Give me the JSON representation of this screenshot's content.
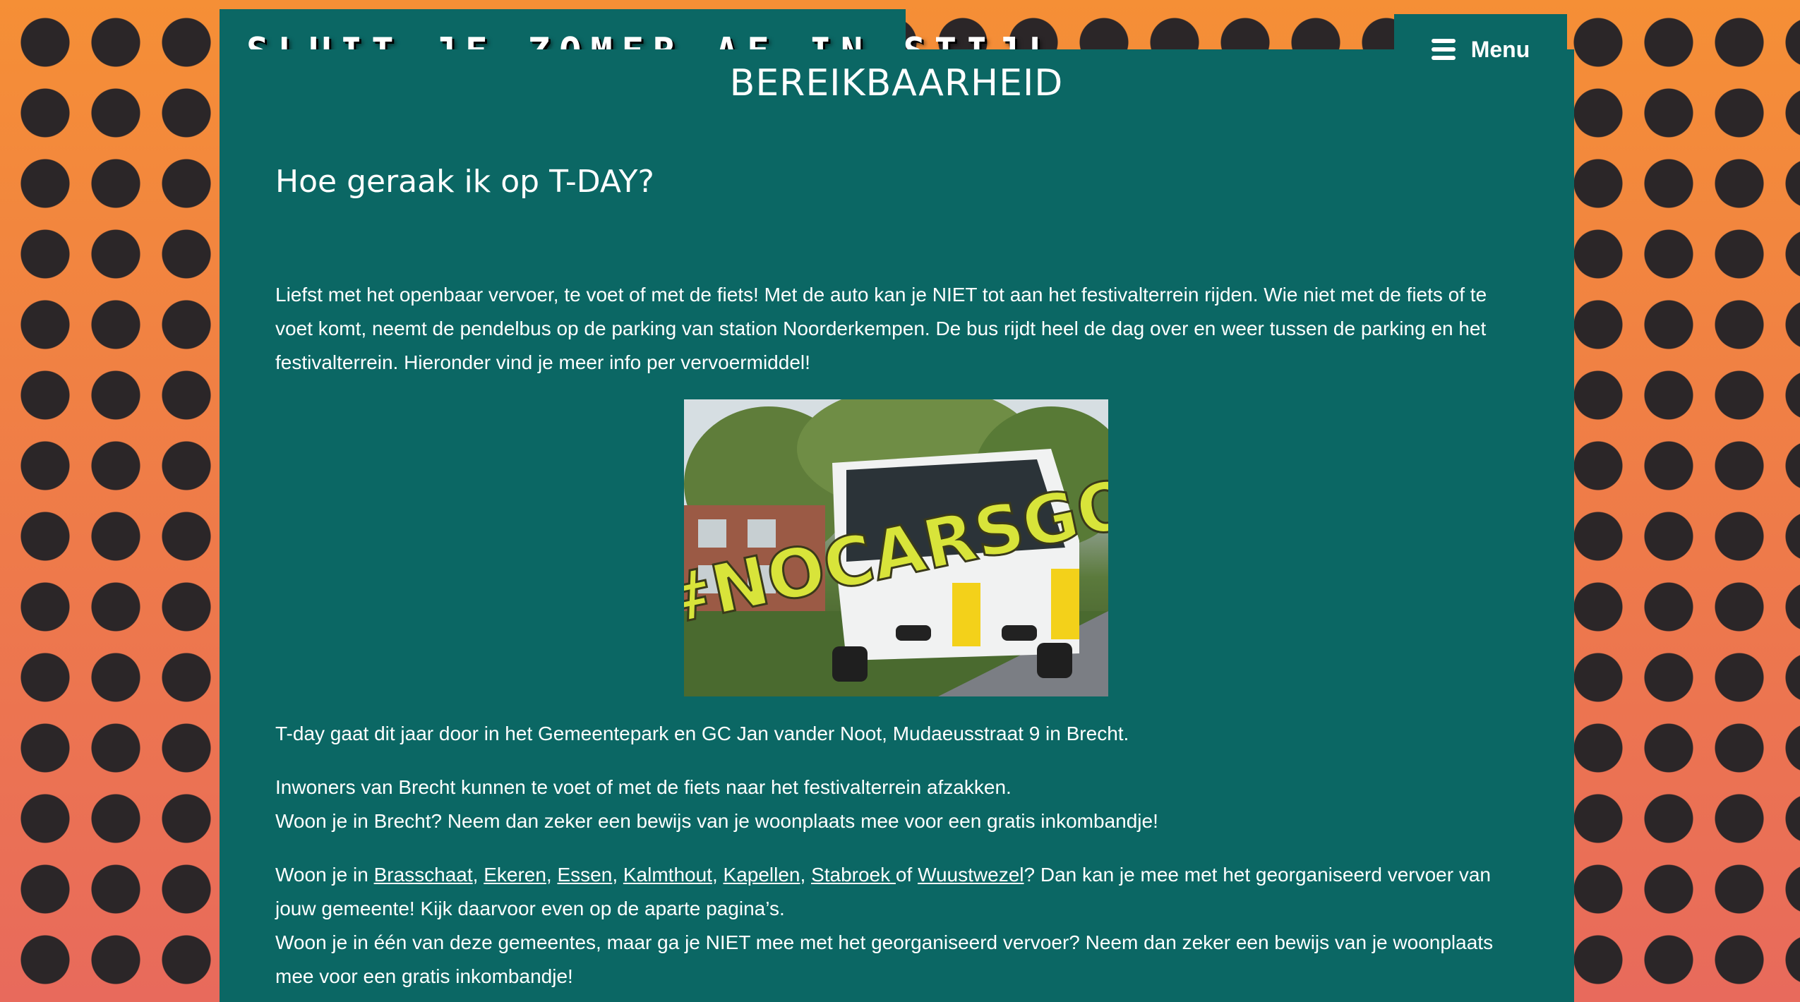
{
  "header": {
    "site_title": "SLUIT JE ZOMER AF IN STIJL",
    "menu_label": "Menu",
    "menu_icon": "hamburger-icon"
  },
  "main": {
    "page_title": "BEREIKBAARHEID",
    "section_title": "Hoe geraak ik op T-DAY?",
    "intro": "Liefst met het openbaar vervoer, te voet of met de fiets! Met de auto kan je NIET tot aan het festivalterrein rijden. Wie niet met de fiets of te voet komt, neemt de pendelbus op de parking van station Noorderkempen. De bus rijdt heel de dag over en weer tussen de parking en het festivalterrein. Hieronder vind je meer info per vervoermiddel!",
    "image": {
      "overlay_text": "#NOCARSGO"
    },
    "location": "T-day gaat dit jaar door in het Gemeentepark en GC Jan vander Noot, Mudaeusstraat 9 in Brecht.",
    "brecht_line1": "Inwoners van Brecht kunnen te voet of met de fiets naar het festivalterrein afzakken.",
    "brecht_line2": "Woon je in Brecht? Neem dan zeker een bewijs van je woonplaats mee voor een gratis inkombandje!",
    "municipalities": {
      "prefix": "Woon je in ",
      "links": [
        "Brasschaat",
        "Ekeren",
        "Essen",
        "Kalmthout",
        "Kapellen",
        "Stabroek ",
        "Wuustwezel"
      ],
      "separator": ", ",
      "or": "of ",
      "suffix": "? Dan kan je mee met het georganiseerd vervoer van jouw gemeente! Kijk daarvoor even op de aparte pagina’s.",
      "line2": "Woon je in één van deze gemeentes, maar ga je NIET mee met het georganiseerd vervoer? Neem dan zeker een bewijs van je woonplaats mee voor een gratis inkombandje!"
    }
  },
  "colors": {
    "panel": "#0b6764",
    "dots": "#2b2628",
    "background_top": "#f58f36",
    "background_bottom": "#e86a5c",
    "text": "#ffffff"
  }
}
